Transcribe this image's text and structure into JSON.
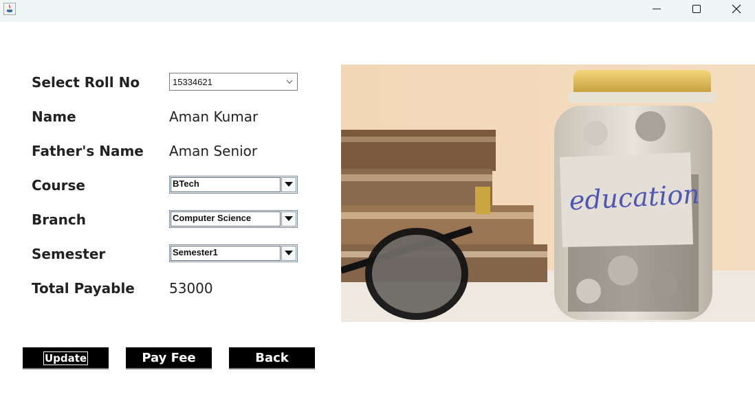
{
  "window": {
    "minimize_icon": "minimize-icon",
    "maximize_icon": "maximize-icon",
    "close_icon": "close-icon",
    "app_icon": "java-icon"
  },
  "form": {
    "roll": {
      "label": "Select Roll No",
      "value": "15334621"
    },
    "name": {
      "label": "Name",
      "value": "Aman Kumar"
    },
    "father": {
      "label": "Father's Name",
      "value": "Aman Senior"
    },
    "course": {
      "label": "Course",
      "value": "BTech"
    },
    "branch": {
      "label": "Branch",
      "value": "Computer Science"
    },
    "semester": {
      "label": "Semester",
      "value": "Semester1"
    },
    "total": {
      "label": "Total Payable",
      "value": "53000"
    }
  },
  "image": {
    "jar_label": "education"
  },
  "buttons": {
    "update": "Update",
    "pay_fee": "Pay Fee",
    "back": "Back"
  }
}
